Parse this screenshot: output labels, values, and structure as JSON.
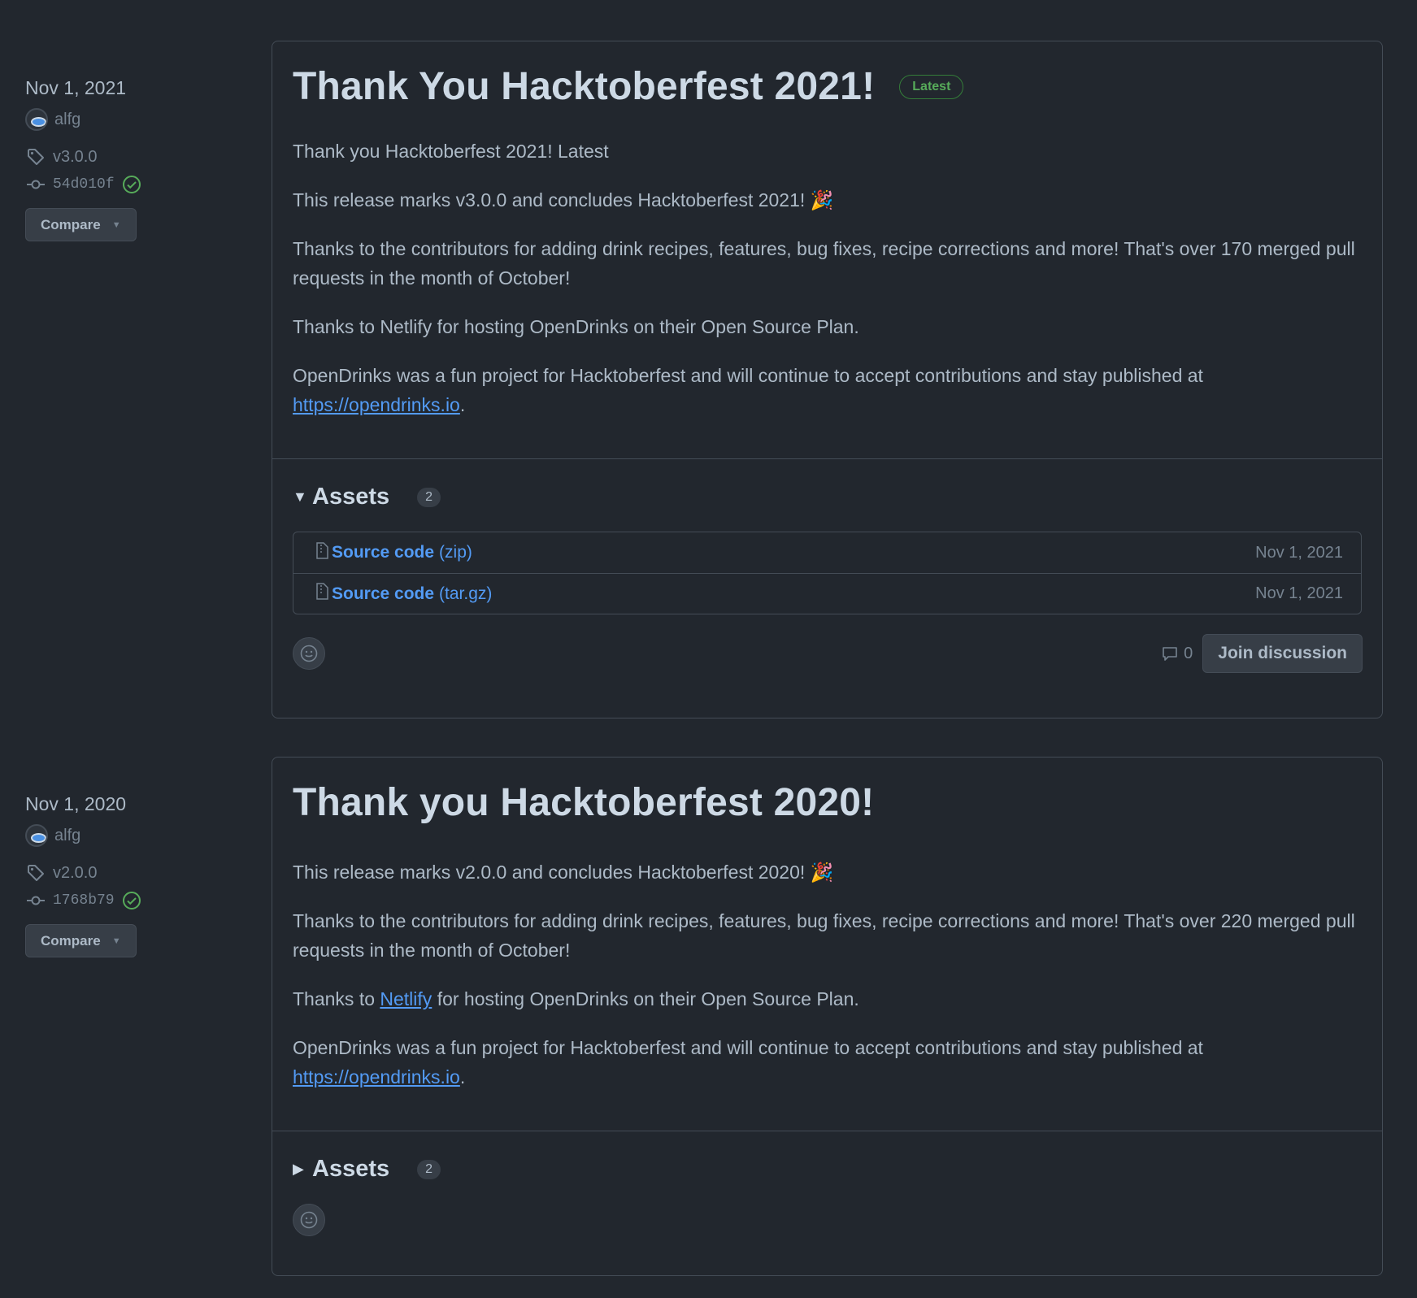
{
  "releases": [
    {
      "date": "Nov 1, 2021",
      "author": "alfg",
      "tag": "v3.0.0",
      "commit": "54d010f",
      "compare_label": "Compare",
      "title": "Thank You Hacktoberfest 2021!",
      "badge": "Latest",
      "body": {
        "p1": "Thank you Hacktoberfest 2021! Latest",
        "p2": "This release marks v3.0.0 and concludes Hacktoberfest 2021! 🎉",
        "p3": "Thanks to the contributors for adding drink recipes, features, bug fixes, recipe corrections and more! That's over 170 merged pull requests in the month of October!",
        "p4": "Thanks to Netlify for hosting OpenDrinks on their Open Source Plan.",
        "p5_prefix": "OpenDrinks was a fun project for Hacktoberfest and will continue to accept contributions and stay published at",
        "p5_link": "https://opendrinks.io",
        "p5_suffix": "."
      },
      "assets_label": "Assets",
      "assets_count": "2",
      "assets": [
        {
          "label": "Source code",
          "ext": "(zip)",
          "date": "Nov 1, 2021"
        },
        {
          "label": "Source code",
          "ext": "(tar.gz)",
          "date": "Nov 1, 2021"
        }
      ],
      "comments": "0",
      "join_label": "Join discussion"
    },
    {
      "date": "Nov 1, 2020",
      "author": "alfg",
      "tag": "v2.0.0",
      "commit": "1768b79",
      "compare_label": "Compare",
      "title": "Thank you Hacktoberfest 2020!",
      "body": {
        "p1": "This release marks v2.0.0 and concludes Hacktoberfest 2020! 🎉",
        "p2": "Thanks to the contributors for adding drink recipes, features, bug fixes, recipe corrections and more! That's over 220 merged pull requests in the month of October!",
        "p3_prefix": "Thanks to",
        "p3_link": "Netlify",
        "p3_suffix": "for hosting OpenDrinks on their Open Source Plan.",
        "p4_prefix": "OpenDrinks was a fun project for Hacktoberfest and will continue to accept contributions and stay published at",
        "p4_link": "https://opendrinks.io",
        "p4_suffix": "."
      },
      "assets_label": "Assets",
      "assets_count": "2"
    }
  ],
  "colors": {
    "background": "#22272e",
    "border": "#444c56",
    "link": "#539bf5",
    "success": "#57ab5a",
    "text": "#adbac7",
    "heading": "#cdd9e5"
  }
}
